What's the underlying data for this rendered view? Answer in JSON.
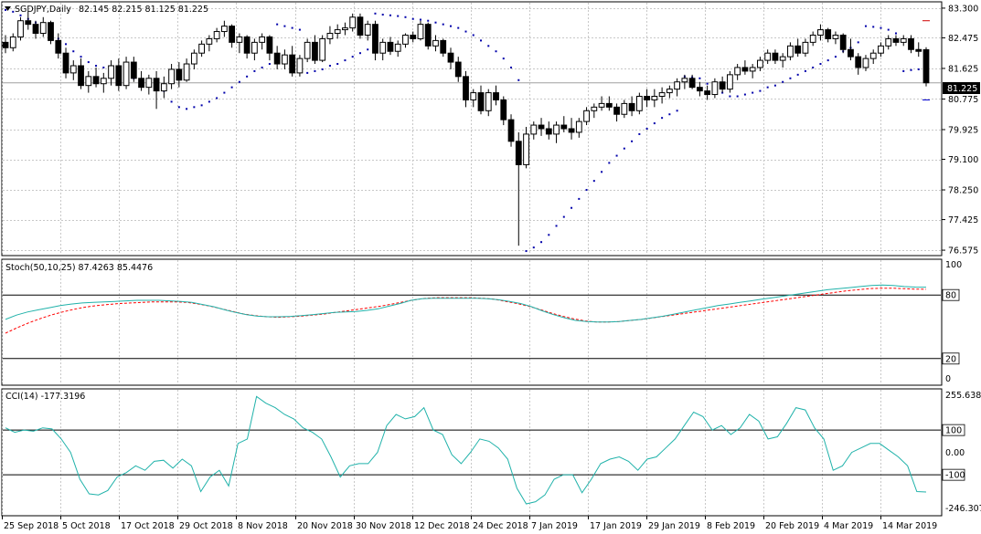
{
  "window": {
    "symbol_title": "SGDJPY,Daily",
    "ohlc": "82.145 82.215 81.125 81.225",
    "menu_icon": "triangle-down-icon"
  },
  "colors": {
    "background": "#ffffff",
    "grid": "#c8c8c8",
    "frame": "#000000",
    "candle_bull": "#ffffff",
    "candle_bear": "#000000",
    "sar": "#0000aa",
    "stoch_main": "#20b2aa",
    "stoch_signal": "#ff0000",
    "cci": "#20b2aa",
    "price_tag_bg": "#000000",
    "price_tag_text": "#ffffff"
  },
  "price_panel": {
    "axis_labels": [
      "83.300",
      "82.475",
      "81.625",
      "80.775",
      "79.925",
      "79.100",
      "78.250",
      "77.425",
      "76.575"
    ],
    "axis_values": [
      83.3,
      82.475,
      81.625,
      80.775,
      79.925,
      79.1,
      78.25,
      77.425,
      76.575
    ],
    "current_price_label": "81.225",
    "current_price": 81.225
  },
  "stoch_panel": {
    "title": "Stoch(50,10,25) 87.4263 85.4476",
    "axis_labels": [
      "100",
      "80",
      "20",
      "0"
    ],
    "levels": [
      80,
      20
    ]
  },
  "cci_panel": {
    "title": "CCI(14) -177.3196",
    "axis_labels": [
      "255.6389",
      "100",
      "0.00",
      "-100",
      "-246.307"
    ],
    "levels": [
      100,
      -100
    ]
  },
  "time_axis": {
    "labels": [
      "25 Sep 2018",
      "5 Oct 2018",
      "17 Oct 2018",
      "29 Oct 2018",
      "8 Nov 2018",
      "20 Nov 2018",
      "30 Nov 2018",
      "12 Dec 2018",
      "24 Dec 2018",
      "7 Jan 2019",
      "17 Jan 2019",
      "29 Jan 2019",
      "8 Feb 2019",
      "20 Feb 2019",
      "4 Mar 2019",
      "14 Mar 2019"
    ]
  },
  "chart_data": {
    "type": "candlestick",
    "title": "SGDJPY,Daily",
    "ylim": [
      76.45,
      83.45
    ],
    "candles": [
      [
        82.35,
        82.55,
        82.05,
        82.2
      ],
      [
        82.2,
        82.6,
        82.1,
        82.5
      ],
      [
        82.5,
        83.05,
        82.4,
        82.95
      ],
      [
        82.95,
        83.2,
        82.7,
        82.85
      ],
      [
        82.85,
        82.95,
        82.45,
        82.6
      ],
      [
        82.6,
        83.05,
        82.5,
        82.9
      ],
      [
        82.9,
        82.95,
        82.3,
        82.4
      ],
      [
        82.4,
        82.6,
        81.9,
        82.05
      ],
      [
        82.05,
        82.2,
        81.35,
        81.5
      ],
      [
        81.5,
        81.85,
        81.3,
        81.7
      ],
      [
        81.7,
        81.9,
        81.05,
        81.15
      ],
      [
        81.15,
        81.55,
        80.95,
        81.4
      ],
      [
        81.4,
        81.65,
        81.1,
        81.2
      ],
      [
        81.2,
        81.5,
        80.95,
        81.35
      ],
      [
        81.35,
        81.85,
        81.15,
        81.7
      ],
      [
        81.7,
        81.9,
        81.0,
        81.15
      ],
      [
        81.15,
        81.95,
        81.05,
        81.8
      ],
      [
        81.8,
        81.95,
        81.25,
        81.35
      ],
      [
        81.35,
        81.55,
        81.0,
        81.1
      ],
      [
        81.1,
        81.45,
        80.9,
        81.35
      ],
      [
        81.35,
        81.55,
        80.5,
        81.0
      ],
      [
        81.0,
        81.4,
        80.8,
        81.2
      ],
      [
        81.2,
        81.75,
        81.05,
        81.6
      ],
      [
        81.6,
        81.8,
        81.1,
        81.3
      ],
      [
        81.3,
        81.9,
        81.25,
        81.75
      ],
      [
        81.75,
        82.15,
        81.6,
        82.05
      ],
      [
        82.05,
        82.4,
        81.95,
        82.3
      ],
      [
        82.3,
        82.55,
        82.1,
        82.45
      ],
      [
        82.45,
        82.75,
        82.35,
        82.65
      ],
      [
        82.65,
        82.95,
        82.5,
        82.8
      ],
      [
        82.8,
        82.85,
        82.2,
        82.35
      ],
      [
        82.35,
        82.6,
        82.05,
        82.5
      ],
      [
        82.5,
        82.55,
        81.9,
        82.05
      ],
      [
        82.05,
        82.45,
        81.85,
        82.35
      ],
      [
        82.35,
        82.6,
        82.15,
        82.5
      ],
      [
        82.5,
        82.55,
        81.85,
        82.05
      ],
      [
        82.05,
        82.25,
        81.6,
        81.75
      ],
      [
        81.75,
        82.15,
        81.6,
        82.0
      ],
      [
        82.0,
        82.25,
        81.4,
        81.5
      ],
      [
        81.5,
        82.0,
        81.4,
        81.9
      ],
      [
        81.9,
        82.45,
        81.8,
        82.35
      ],
      [
        82.35,
        82.55,
        81.75,
        81.85
      ],
      [
        81.85,
        82.55,
        81.8,
        82.45
      ],
      [
        82.45,
        82.8,
        82.3,
        82.6
      ],
      [
        82.6,
        82.85,
        82.45,
        82.7
      ],
      [
        82.7,
        82.9,
        82.55,
        82.75
      ],
      [
        82.75,
        83.15,
        82.65,
        83.05
      ],
      [
        83.05,
        83.15,
        82.45,
        82.55
      ],
      [
        82.55,
        82.95,
        82.4,
        82.85
      ],
      [
        82.85,
        82.95,
        81.85,
        82.05
      ],
      [
        82.05,
        82.45,
        81.85,
        82.35
      ],
      [
        82.35,
        82.5,
        82.0,
        82.1
      ],
      [
        82.1,
        82.4,
        81.95,
        82.3
      ],
      [
        82.3,
        82.6,
        82.2,
        82.55
      ],
      [
        82.55,
        82.65,
        82.35,
        82.45
      ],
      [
        82.45,
        82.95,
        82.4,
        82.85
      ],
      [
        82.85,
        82.9,
        82.15,
        82.25
      ],
      [
        82.25,
        82.55,
        82.1,
        82.4
      ],
      [
        82.4,
        82.45,
        81.95,
        82.05
      ],
      [
        82.05,
        82.2,
        81.6,
        81.8
      ],
      [
        81.8,
        81.95,
        81.25,
        81.4
      ],
      [
        81.4,
        81.55,
        80.55,
        80.75
      ],
      [
        80.75,
        81.05,
        80.55,
        80.95
      ],
      [
        80.95,
        81.15,
        80.35,
        80.45
      ],
      [
        80.45,
        81.05,
        80.3,
        80.95
      ],
      [
        80.95,
        81.15,
        80.6,
        80.75
      ],
      [
        80.75,
        80.85,
        80.05,
        80.2
      ],
      [
        80.2,
        80.35,
        79.45,
        79.6
      ],
      [
        79.6,
        79.85,
        76.7,
        78.95
      ],
      [
        78.95,
        80.0,
        78.85,
        79.8
      ],
      [
        79.8,
        80.15,
        79.65,
        80.05
      ],
      [
        80.05,
        80.25,
        79.75,
        79.95
      ],
      [
        79.95,
        80.15,
        79.65,
        79.8
      ],
      [
        79.8,
        80.15,
        79.55,
        80.05
      ],
      [
        80.05,
        80.3,
        79.85,
        79.95
      ],
      [
        79.95,
        80.25,
        79.65,
        79.85
      ],
      [
        79.85,
        80.25,
        79.7,
        80.15
      ],
      [
        80.15,
        80.55,
        80.05,
        80.45
      ],
      [
        80.45,
        80.65,
        80.25,
        80.55
      ],
      [
        80.55,
        80.85,
        80.45,
        80.65
      ],
      [
        80.65,
        80.85,
        80.45,
        80.55
      ],
      [
        80.55,
        80.65,
        80.15,
        80.35
      ],
      [
        80.35,
        80.75,
        80.25,
        80.65
      ],
      [
        80.65,
        80.85,
        80.3,
        80.45
      ],
      [
        80.45,
        80.95,
        80.35,
        80.85
      ],
      [
        80.85,
        81.05,
        80.55,
        80.75
      ],
      [
        80.75,
        81.05,
        80.55,
        80.85
      ],
      [
        80.85,
        81.1,
        80.65,
        80.95
      ],
      [
        80.95,
        81.15,
        80.8,
        81.05
      ],
      [
        81.05,
        81.35,
        80.85,
        81.25
      ],
      [
        81.25,
        81.45,
        81.05,
        81.35
      ],
      [
        81.35,
        81.45,
        81.05,
        81.1
      ],
      [
        81.1,
        81.25,
        80.85,
        81.0
      ],
      [
        81.0,
        81.15,
        80.75,
        80.9
      ],
      [
        80.9,
        81.35,
        80.8,
        81.25
      ],
      [
        81.25,
        81.4,
        80.95,
        81.05
      ],
      [
        81.05,
        81.55,
        80.95,
        81.45
      ],
      [
        81.45,
        81.75,
        81.3,
        81.65
      ],
      [
        81.65,
        81.85,
        81.45,
        81.55
      ],
      [
        81.55,
        81.75,
        81.35,
        81.65
      ],
      [
        81.65,
        81.95,
        81.55,
        81.85
      ],
      [
        81.85,
        82.15,
        81.75,
        82.05
      ],
      [
        82.05,
        82.15,
        81.75,
        81.85
      ],
      [
        81.85,
        82.05,
        81.65,
        81.95
      ],
      [
        81.95,
        82.35,
        81.85,
        82.25
      ],
      [
        82.25,
        82.45,
        81.95,
        82.05
      ],
      [
        82.05,
        82.45,
        81.95,
        82.35
      ],
      [
        82.35,
        82.65,
        82.25,
        82.55
      ],
      [
        82.55,
        82.85,
        82.4,
        82.7
      ],
      [
        82.7,
        82.75,
        82.35,
        82.45
      ],
      [
        82.45,
        82.65,
        82.3,
        82.55
      ],
      [
        82.55,
        82.6,
        82.05,
        82.15
      ],
      [
        82.15,
        82.45,
        81.85,
        81.95
      ],
      [
        81.95,
        82.05,
        81.45,
        81.65
      ],
      [
        81.65,
        82.0,
        81.55,
        81.9
      ],
      [
        81.9,
        82.15,
        81.75,
        82.05
      ],
      [
        82.05,
        82.35,
        81.95,
        82.25
      ],
      [
        82.25,
        82.55,
        82.15,
        82.45
      ],
      [
        82.45,
        82.55,
        82.25,
        82.35
      ],
      [
        82.35,
        82.55,
        82.25,
        82.45
      ],
      [
        82.45,
        82.55,
        82.05,
        82.15
      ],
      [
        82.15,
        82.35,
        81.95,
        82.1
      ],
      [
        82.145,
        82.215,
        81.125,
        81.225
      ]
    ],
    "sar": [
      83.25,
      83.2,
      83.1,
      83.0,
      82.9,
      82.75,
      82.6,
      82.45,
      82.3,
      82.1,
      81.95,
      81.8,
      81.7,
      81.65,
      81.6,
      81.55,
      81.45,
      81.35,
      81.3,
      81.25,
      81.2,
      81.0,
      80.7,
      80.55,
      80.5,
      80.55,
      80.6,
      80.7,
      80.8,
      80.95,
      81.1,
      81.25,
      81.4,
      81.55,
      81.65,
      81.75,
      82.85,
      82.8,
      82.75,
      82.7,
      81.5,
      81.55,
      81.6,
      81.7,
      81.75,
      81.85,
      81.95,
      82.05,
      82.15,
      83.15,
      83.12,
      83.1,
      83.08,
      83.05,
      83.0,
      82.98,
      82.95,
      82.9,
      82.85,
      82.8,
      82.75,
      82.65,
      82.55,
      82.4,
      82.25,
      82.1,
      81.9,
      81.65,
      81.3,
      76.55,
      76.65,
      76.8,
      77.0,
      77.25,
      77.5,
      77.75,
      78.0,
      78.25,
      78.5,
      78.75,
      79.0,
      79.2,
      79.4,
      79.6,
      79.8,
      79.95,
      80.1,
      80.25,
      80.35,
      80.45,
      81.4,
      81.38,
      81.35,
      81.2,
      81.05,
      80.95,
      80.85,
      80.85,
      80.9,
      80.95,
      81.0,
      81.1,
      81.15,
      81.25,
      81.35,
      81.45,
      81.55,
      81.65,
      81.75,
      81.85,
      81.95,
      82.1,
      82.2,
      82.35,
      82.8,
      82.78,
      82.75,
      82.7,
      82.6,
      81.55,
      81.58,
      81.6,
      81.65,
      81.7,
      81.75,
      82.95
    ],
    "stoch_main": [
      57,
      61,
      64,
      66,
      68,
      70,
      71.5,
      72.5,
      73,
      73.5,
      74,
      74.5,
      75,
      75,
      75,
      74.5,
      74,
      73,
      71,
      69,
      66,
      63.5,
      61.5,
      60,
      59.5,
      59.5,
      59.8,
      60.5,
      61.5,
      62.5,
      63.5,
      64,
      64.5,
      65.5,
      67,
      69.5,
      72,
      75,
      76.5,
      77,
      77,
      77,
      77,
      77,
      76.5,
      75.5,
      74,
      72,
      69,
      65,
      61.5,
      58.5,
      56,
      55,
      54.5,
      54.5,
      55,
      56,
      57,
      58.5,
      60,
      62,
      64,
      66,
      68,
      70,
      71.5,
      73,
      74.5,
      76,
      77.5,
      79,
      80.5,
      82,
      83.5,
      85,
      86,
      87,
      88,
      89,
      89.5,
      89,
      88,
      87.5,
      87.4263
    ],
    "stoch_signal": [
      44,
      49,
      53.5,
      57.5,
      61,
      64,
      66.5,
      68.5,
      70,
      71,
      72,
      72.5,
      73,
      73.5,
      73.5,
      73.5,
      73,
      71.5,
      69.5,
      67,
      64.5,
      62,
      60.5,
      59.5,
      59,
      59.5,
      60,
      61,
      62,
      63.5,
      65,
      66.5,
      68,
      69.5,
      71.5,
      73.5,
      75.5,
      77,
      77.5,
      77.5,
      77.5,
      77.5,
      77,
      76,
      74,
      72,
      69.5,
      66.5,
      63,
      60,
      57.5,
      55.5,
      54.5,
      54.5,
      55,
      56,
      57,
      58.5,
      60,
      61.5,
      63,
      64.5,
      66,
      67.5,
      69,
      70.5,
      72,
      73.5,
      75,
      76.5,
      78,
      79.5,
      81,
      82.5,
      84,
      85,
      86,
      86.5,
      86.5,
      86,
      85.6,
      85.4476
    ],
    "cci": [
      110,
      90,
      100,
      95,
      110,
      105,
      60,
      0,
      -120,
      -185,
      -190,
      -170,
      -110,
      -90,
      -60,
      -80,
      -40,
      -35,
      -70,
      -30,
      -60,
      -175,
      -110,
      -80,
      -150,
      40,
      60,
      250,
      220,
      200,
      170,
      150,
      110,
      90,
      60,
      -20,
      -110,
      -60,
      -50,
      -50,
      0,
      120,
      170,
      150,
      160,
      200,
      100,
      80,
      -10,
      -50,
      0,
      60,
      50,
      20,
      -30,
      -160,
      -230,
      -220,
      -190,
      -120,
      -100,
      -100,
      -180,
      -120,
      -50,
      -30,
      -20,
      -40,
      -80,
      -30,
      -20,
      20,
      60,
      120,
      180,
      160,
      100,
      120,
      80,
      110,
      170,
      140,
      60,
      70,
      130,
      200,
      190,
      110,
      60,
      -80,
      -60,
      0,
      20,
      40,
      40,
      10,
      -20,
      -60,
      -175,
      -177
    ]
  }
}
